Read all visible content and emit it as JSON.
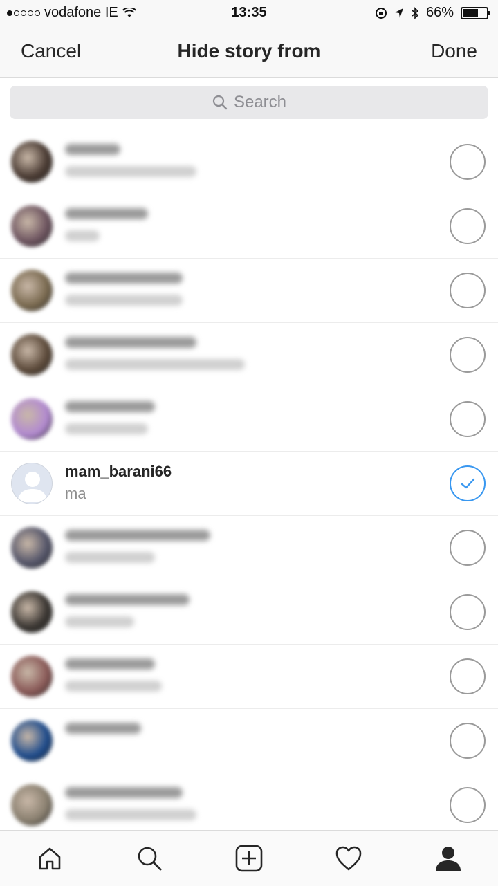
{
  "status_bar": {
    "carrier": "vodafone IE",
    "time": "13:35",
    "battery": "66%",
    "battery_level": 0.66
  },
  "nav": {
    "cancel_label": "Cancel",
    "title": "Hide story from",
    "done_label": "Done"
  },
  "search": {
    "placeholder": "Search"
  },
  "users": [
    {
      "visible": false,
      "selected": false,
      "avatar_color": "#4a3b33"
    },
    {
      "visible": false,
      "selected": false,
      "avatar_color": "#6e5560"
    },
    {
      "visible": false,
      "selected": false,
      "avatar_color": "#7a6a50"
    },
    {
      "visible": false,
      "selected": false,
      "avatar_color": "#5c4a3a"
    },
    {
      "visible": false,
      "selected": false,
      "avatar_color": "#b28ad0"
    },
    {
      "visible": true,
      "selected": true,
      "username": "mam_barani66",
      "full_name": "ma",
      "avatar_color": "#dfe5f0"
    },
    {
      "visible": false,
      "selected": false,
      "avatar_color": "#55566a"
    },
    {
      "visible": false,
      "selected": false,
      "avatar_color": "#3a3632"
    },
    {
      "visible": false,
      "selected": false,
      "avatar_color": "#8a5a58"
    },
    {
      "visible": false,
      "selected": false,
      "avatar_color": "#1f4c8c"
    },
    {
      "visible": false,
      "selected": false,
      "avatar_color": "#8a8070"
    }
  ],
  "tab_bar": {
    "tabs": [
      {
        "icon": "home-icon"
      },
      {
        "icon": "search-icon"
      },
      {
        "icon": "add-post-icon"
      },
      {
        "icon": "heart-icon"
      },
      {
        "icon": "profile-icon",
        "active": true
      }
    ]
  },
  "colors": {
    "accent": "#3897f0",
    "separator": "#ececec"
  }
}
